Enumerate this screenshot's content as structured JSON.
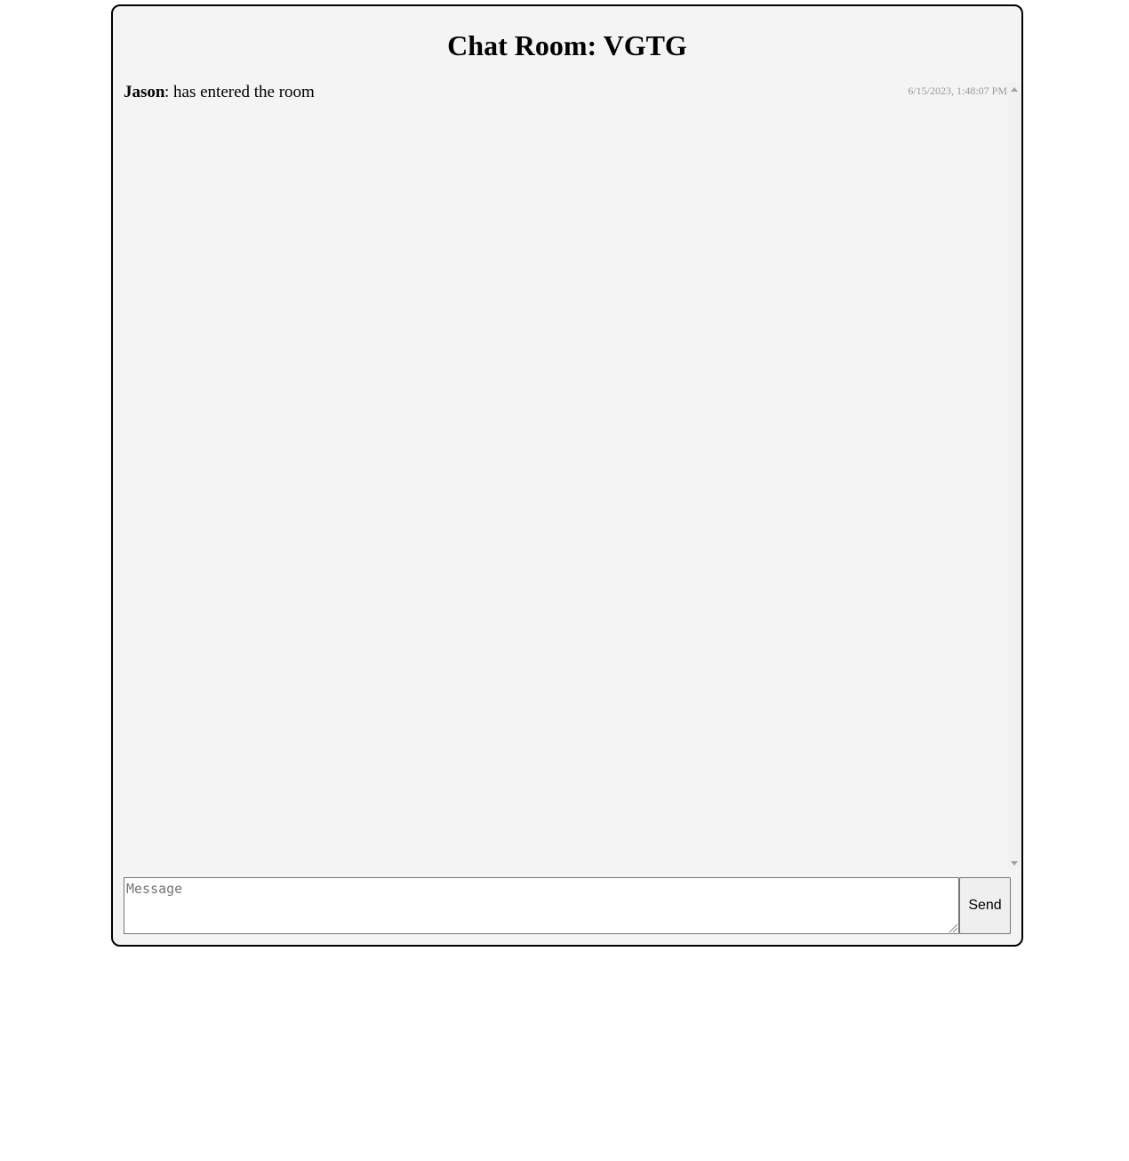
{
  "room": {
    "title": "Chat Room: VGTG"
  },
  "messages": [
    {
      "author": "Jason",
      "text": ": has entered the room",
      "timestamp": "6/15/2023, 1:48:07 PM"
    }
  ],
  "composer": {
    "placeholder": "Message",
    "value": "",
    "send_label": "Send"
  },
  "icons": {
    "scroll_up": "scroll-up-arrow-icon",
    "scroll_down": "scroll-down-arrow-icon",
    "resize": "resize-grip-icon"
  },
  "colors": {
    "panel_background": "#f4f4f4",
    "panel_border": "#000000",
    "timestamp": "#999999"
  }
}
